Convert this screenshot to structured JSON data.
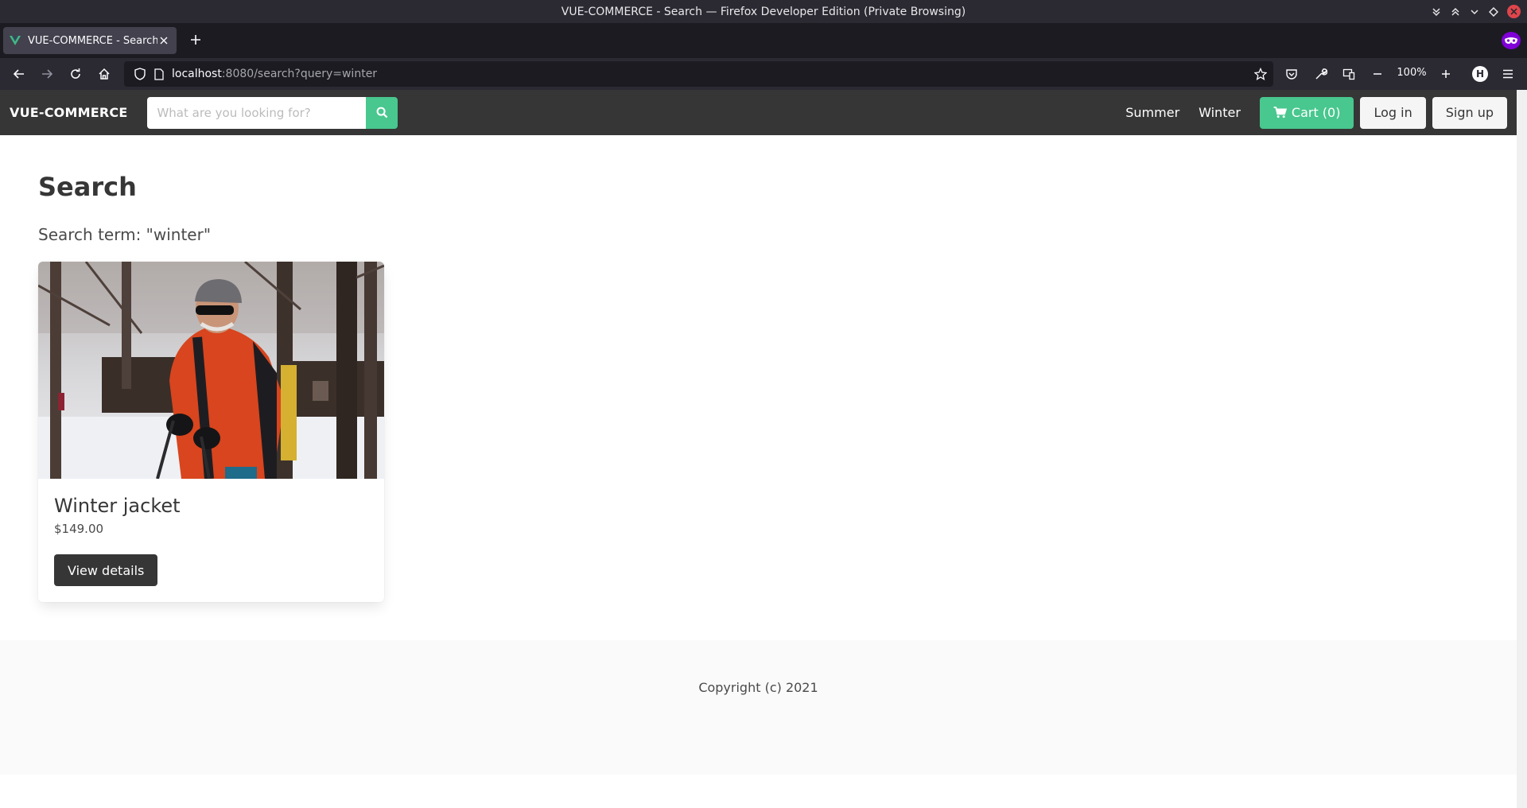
{
  "window": {
    "title": "VUE-COMMERCE - Search — Firefox Developer Edition (Private Browsing)"
  },
  "browser": {
    "tab": {
      "title": "VUE-COMMERCE - Search"
    },
    "url": {
      "host": "localhost",
      "rest": ":8080/search?query=winter"
    },
    "zoom": "100%",
    "account_initial": "H"
  },
  "site": {
    "brand": "VUE-COMMERCE",
    "search": {
      "placeholder": "What are you looking for?"
    },
    "nav_links": [
      "Summer",
      "Winter"
    ],
    "cart_label": "Cart (0)",
    "login_label": "Log in",
    "signup_label": "Sign up",
    "accent_color": "#48c78e",
    "navbar_color": "#363636"
  },
  "page": {
    "title": "Search",
    "search_term_text": "Search term: \"winter\""
  },
  "results": [
    {
      "name": "Winter jacket",
      "price": "$149.00",
      "button_label": "View details"
    }
  ],
  "footer": {
    "copyright": "Copyright (c) 2021"
  }
}
